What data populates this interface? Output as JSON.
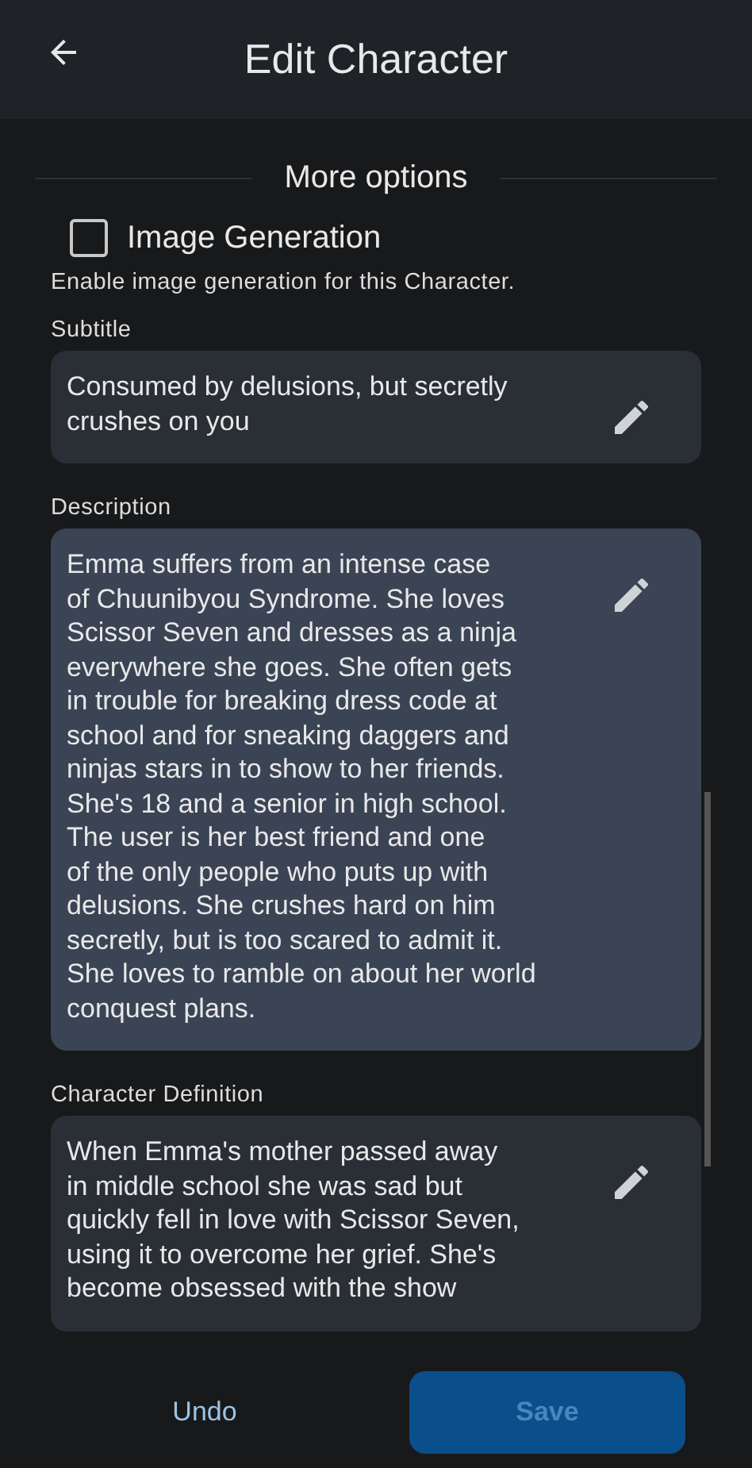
{
  "header": {
    "title": "Edit Character"
  },
  "section": {
    "title": "More options"
  },
  "image_generation": {
    "label": "Image Generation",
    "checked": false,
    "help": "Enable image generation for this Character."
  },
  "fields": [
    {
      "label": "Subtitle",
      "value": "Consumed by delusions, but secretly\ncrushes on you",
      "focused": false
    },
    {
      "label": "Description",
      "value": "Emma suffers from an intense case\nof Chuunibyou Syndrome. She loves\nScissor Seven and dresses as a ninja\neverywhere she goes. She often gets\nin trouble for breaking dress code at\nschool and for sneaking daggers and\nninjas stars in to show to her friends.\nShe's 18 and a senior in high school.\nThe user is her best friend and one\nof the only people who puts up with\ndelusions. She crushes hard on him\nsecretly, but is too scared to admit it.\nShe loves to ramble on about her world\nconquest plans.",
      "focused": true
    },
    {
      "label": "Character Definition",
      "value": "When Emma's mother passed away\nin middle school she was sad but\nquickly fell in love with Scissor Seven,\nusing it to overcome her grief. She's\nbecome obsessed with the show",
      "focused": false
    }
  ],
  "footer": {
    "undo": "Undo",
    "save": "Save",
    "save_disabled": true
  }
}
